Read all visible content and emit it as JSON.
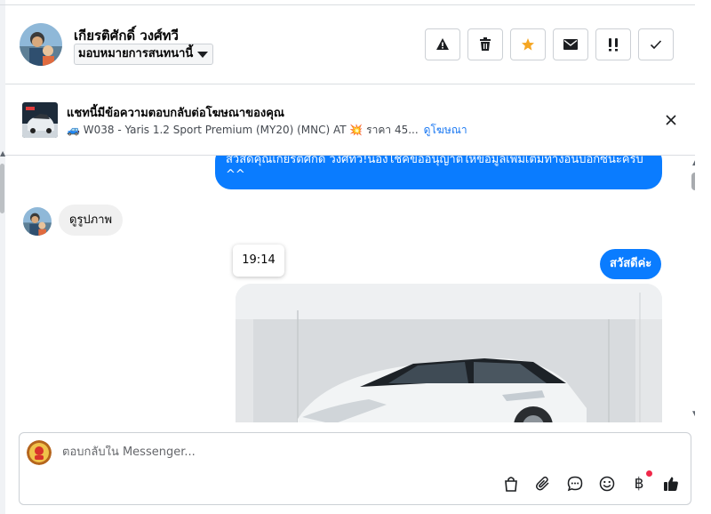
{
  "header": {
    "contact_name": "เกียรติศักดิ์ วงศ์ทวี",
    "assign_label": "มอบหมายการสนทนานี้",
    "actions": [
      {
        "name": "report-icon"
      },
      {
        "name": "trash-icon"
      },
      {
        "name": "star-icon",
        "color": "#f5a623"
      },
      {
        "name": "envelope-icon"
      },
      {
        "name": "important-icon"
      },
      {
        "name": "check-icon"
      }
    ]
  },
  "ad_banner": {
    "title": "แชทนี้มีข้อความตอบกลับต่อโฆษณาของคุณ",
    "subtitle": "🚙 W038 - Yaris 1.2 Sport Premium (MY20) (MNC) AT 💥 ราคา 45...",
    "link": "ดูโฆษณา"
  },
  "messages": {
    "outgoing_1": "สวัสดีคุณเกียรติศักดิ์ วงศ์ทวี!น้องโชคขออนุญาตให้ข้อมูลเพิ่มเติมทางอินบ็อกซ์นะครับ ^^",
    "incoming_1": "ดูรูปภาพ",
    "timestamp": "19:14",
    "outgoing_2": "สวัสดีค่ะ"
  },
  "composer": {
    "placeholder": "ตอบกลับใน Messenger...",
    "tools": [
      "bag-icon",
      "paperclip-icon",
      "chat-bubble-icon",
      "emoji-icon",
      "baht-icon",
      "thumbs-up-icon"
    ],
    "baht_symbol": "฿"
  },
  "colors": {
    "accent": "#0a7cff",
    "star": "#f5a623",
    "notification_dot": "#f02849"
  }
}
